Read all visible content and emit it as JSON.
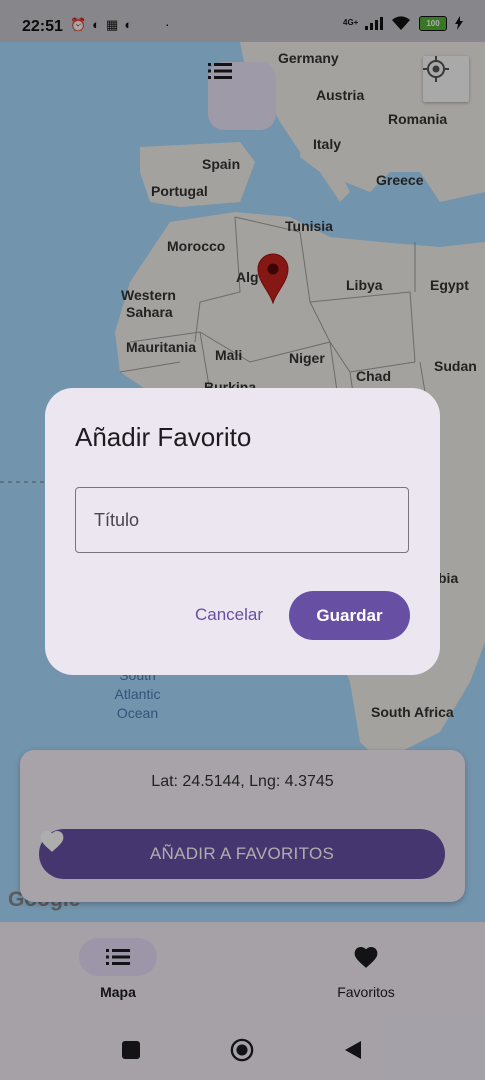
{
  "status_bar": {
    "time": "22:51",
    "notification_icons": [
      "alarm-icon",
      "app-icon",
      "grid-icon",
      "app-icon"
    ],
    "network": "4G+",
    "battery": "100"
  },
  "map": {
    "countries": [
      "Germany",
      "Austria",
      "Romania",
      "Italy",
      "Spain",
      "Greece",
      "Portugal",
      "Tunisia",
      "Morocco",
      "Alg",
      "Libya",
      "Egypt",
      "Western",
      "Sahara",
      "Mauritania",
      "Mali",
      "Niger",
      "Sudan",
      "Chad",
      "Burkina",
      "bia",
      "South Africa"
    ],
    "ocean": [
      "South",
      "Atlantic",
      "Ocean"
    ],
    "attribution": "Google",
    "marker_color": "#c5221f"
  },
  "info_card": {
    "coords_text": "Lat: 24.5144, Lng: 4.3745",
    "add_button_label": "AÑADIR A FAVORITOS"
  },
  "bottom_nav": {
    "items": [
      {
        "label": "Mapa",
        "icon": "list-icon",
        "active": true
      },
      {
        "label": "Favoritos",
        "icon": "heart-icon",
        "active": false
      }
    ]
  },
  "dialog": {
    "title": "Añadir Favorito",
    "title_field_placeholder": "Título",
    "cancel_label": "Cancelar",
    "save_label": "Guardar"
  },
  "colors": {
    "primary": "#6750a4",
    "dialog_bg": "#ece6f0",
    "nav_bg": "#f3edf7"
  }
}
